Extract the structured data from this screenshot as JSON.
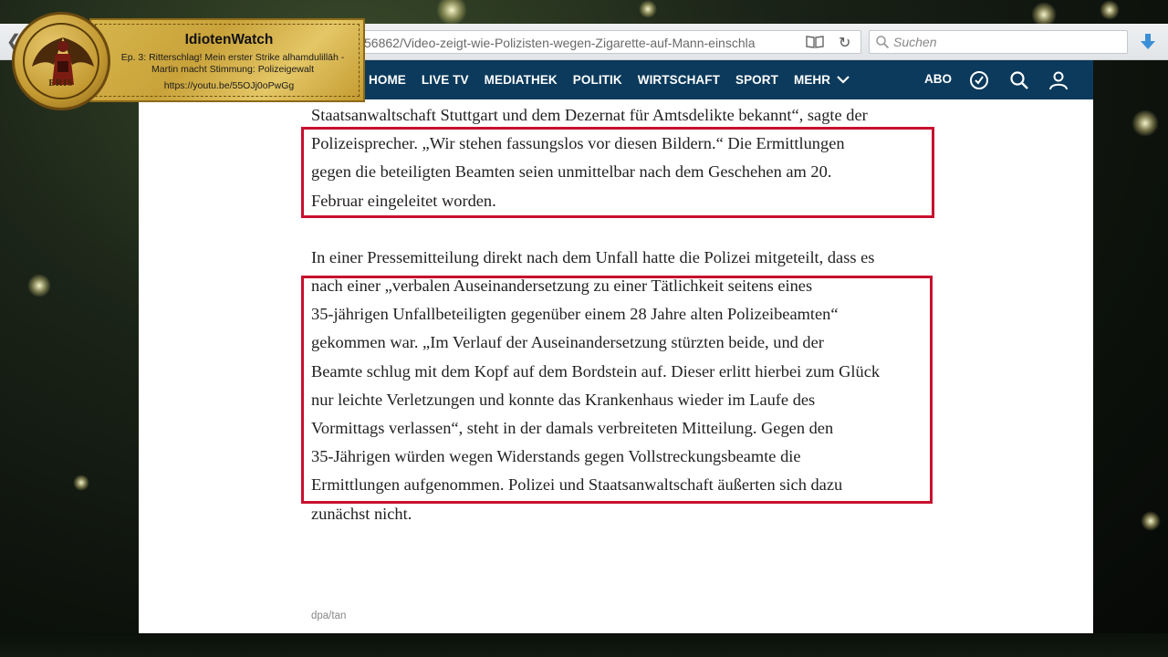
{
  "browser": {
    "url": "56862/Video-zeigt-wie-Polizisten-wegen-Zigarette-auf-Mann-einschla",
    "search_placeholder": "Suchen"
  },
  "site_nav": {
    "items": [
      "HOME",
      "LIVE TV",
      "MEDIATHEK",
      "POLITIK",
      "WIRTSCHAFT",
      "SPORT",
      "MEHR"
    ],
    "abo": "ABO"
  },
  "overlay": {
    "title": "IdiotenWatch",
    "subtitle_line1": "Ep. 3: Ritterschlag! Mein erster Strike alhamdulillāh -",
    "subtitle_line2": "Martin macht Stimmung: Polizeigewalt",
    "link": "https://youtu.be/55OJj0oPwGg",
    "logo_text": "ERIS"
  },
  "article": {
    "lines": [
      "Staatsanwaltschaft Stuttgart und dem Dezernat für Amtsdelikte bekannt“, sagte der",
      "Polizeisprecher. „Wir stehen fassungslos vor diesen Bildern.“ Die Ermittlungen",
      "gegen die beteiligten Beamten seien unmittelbar nach dem Geschehen am 20.",
      "Februar eingeleitet worden.",
      "",
      "In einer Pressemitteilung direkt nach dem Unfall hatte die Polizei mitgeteilt, dass es",
      "nach einer „verbalen Auseinandersetzung zu einer Tätlichkeit seitens eines",
      "35-jährigen Unfallbeteiligten gegenüber einem 28 Jahre alten Polizeibeamten“",
      "gekommen war. „Im Verlauf der Auseinandersetzung stürzten beide, und der",
      "Beamte schlug mit dem Kopf auf dem Bordstein auf. Dieser erlitt hierbei zum Glück",
      "nur leichte Verletzungen und konnte das Krankenhaus wieder im Laufe des",
      "Vormittags verlassen“, steht in der damals verbreiteten Mitteilung. Gegen den",
      "35-Jährigen würden wegen Widerstands gegen Vollstreckungsbeamte die",
      "Ermittlungen aufgenommen. Polizei und Staatsanwaltschaft äußerten sich dazu",
      "zunächst nicht."
    ],
    "credit": "dpa/tan"
  },
  "colors": {
    "nav_bg": "#0b3a5c",
    "highlight": "#c8102e"
  }
}
